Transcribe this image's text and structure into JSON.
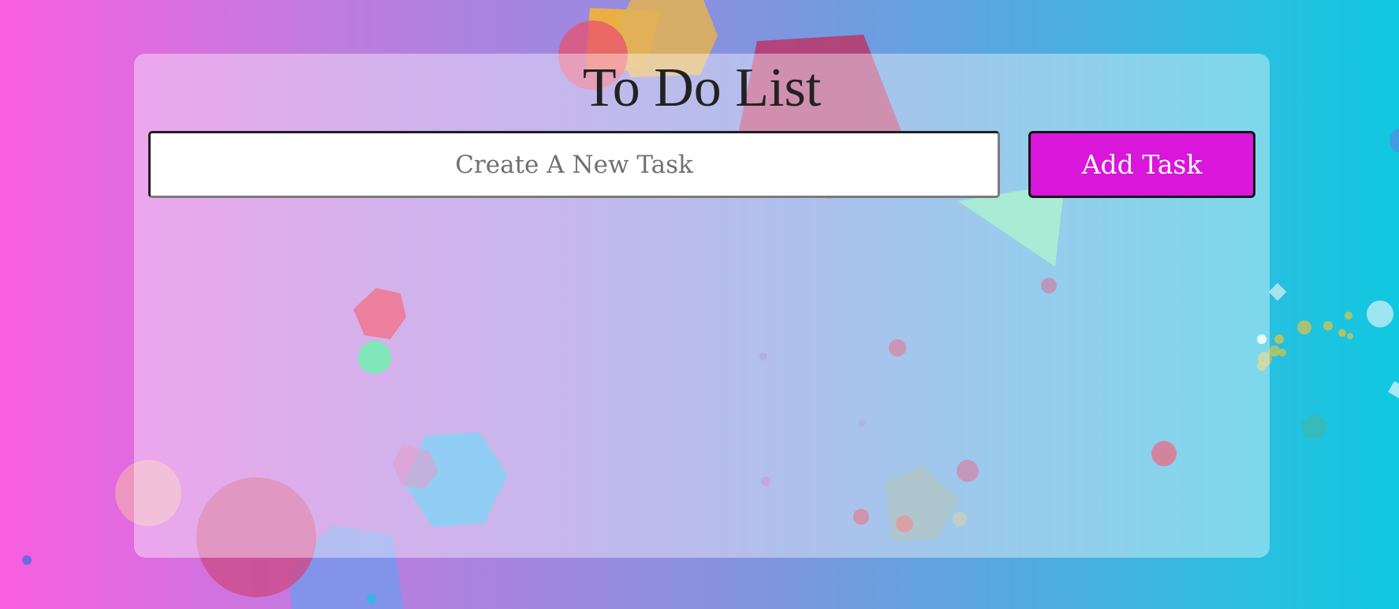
{
  "app": {
    "title": "To Do List"
  },
  "task_form": {
    "input_value": "",
    "input_placeholder": "Create A New Task",
    "add_button_label": "Add Task"
  },
  "colors": {
    "background_left": "#f85ee0",
    "background_right": "#10c8e0",
    "add_button": "#d916d9",
    "title_text": "#222222"
  }
}
